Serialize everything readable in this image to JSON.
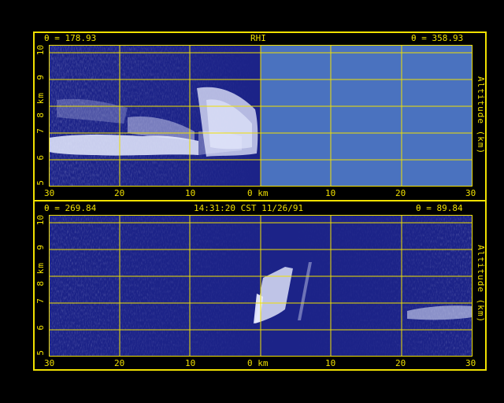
{
  "top_panel": {
    "header_left": "θ = 178.93",
    "header_center": "RHI",
    "header_right": "θ = 358.93",
    "y_ticks": [
      "10",
      "9",
      "8",
      "7",
      "6",
      "5"
    ],
    "y_label_left": "km",
    "y_label_right": "Altitude (km)",
    "x_ticks": [
      "30",
      "20",
      "10",
      "0 km",
      "10",
      "20",
      "30"
    ]
  },
  "bottom_panel": {
    "header_left": "θ = 269.84",
    "header_center": "14:31:20 CST 11/26/91",
    "header_right": "θ = 89.84",
    "y_ticks": [
      "10",
      "9",
      "8",
      "7",
      "6",
      "5"
    ],
    "y_label_left": "km",
    "y_label_right": "Altitude (km)",
    "x_ticks": [
      "30",
      "20",
      "10",
      "0 km",
      "10",
      "20",
      "30"
    ]
  },
  "colors": {
    "frame": "#f0e000",
    "background": "#1c2388",
    "no_data": "#4a72bf",
    "echo": "#e8ecff"
  }
}
